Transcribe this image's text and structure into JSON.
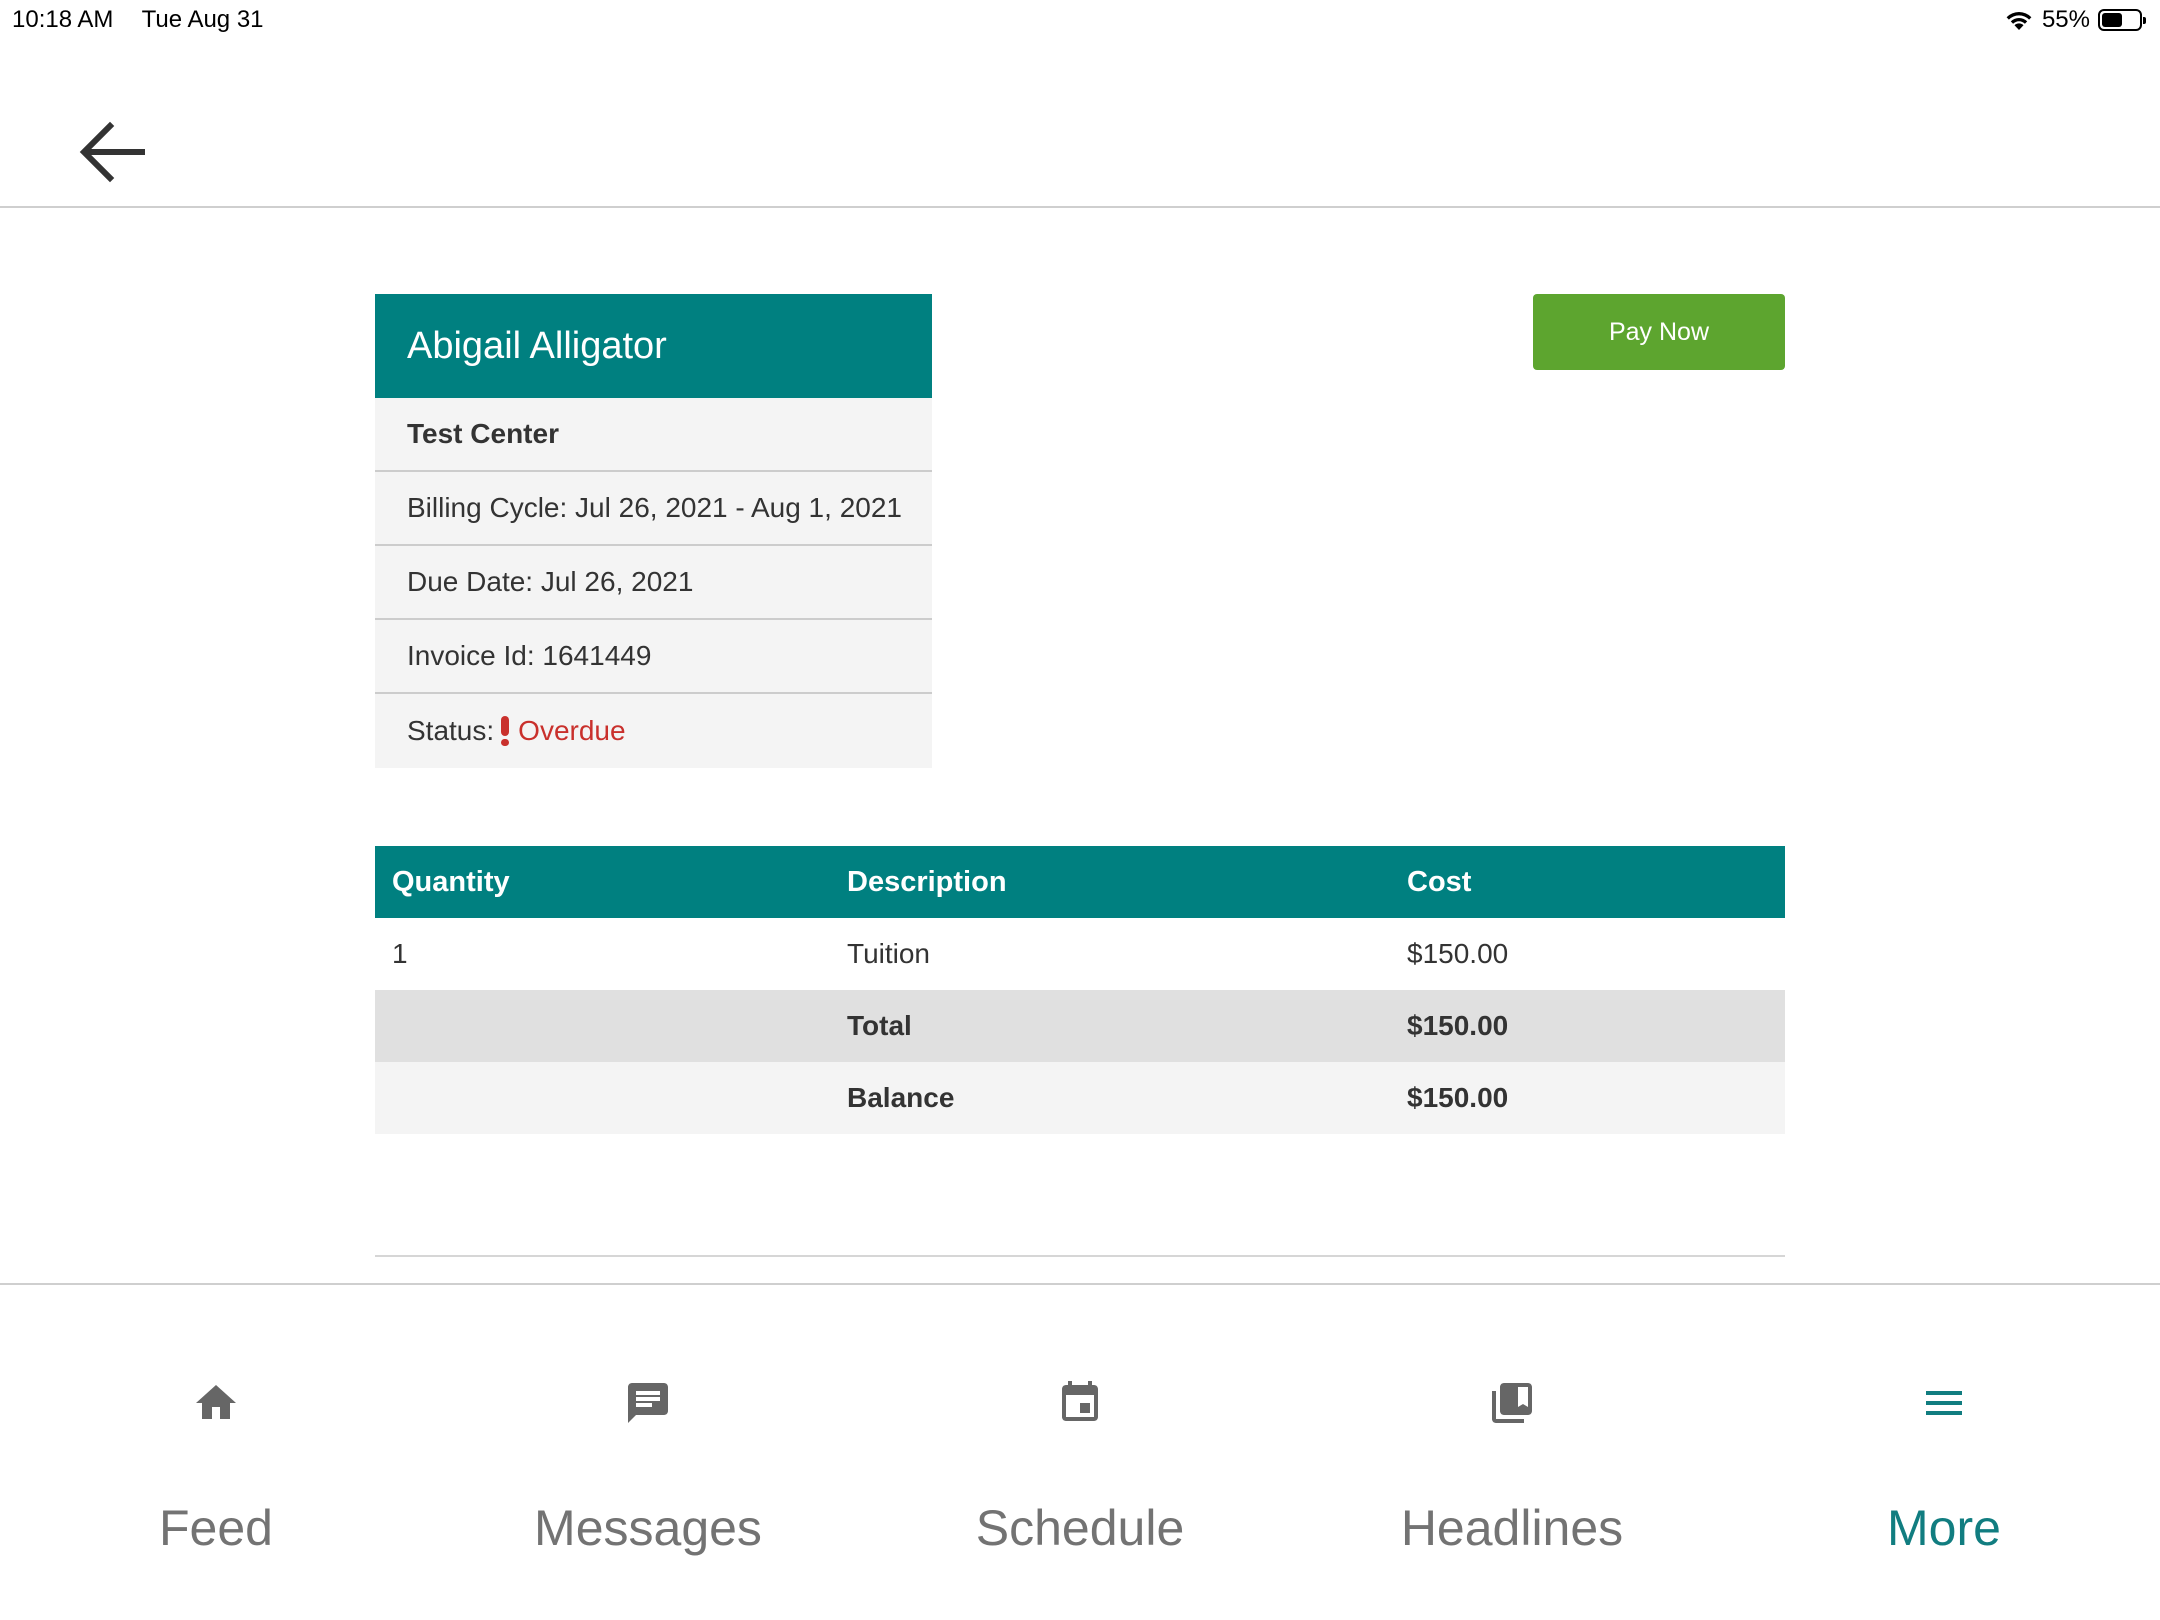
{
  "status_bar": {
    "time": "10:18 AM",
    "date": "Tue Aug 31",
    "battery_percent": "55%",
    "battery_level": 0.55,
    "icons": [
      "wifi-icon",
      "battery-icon"
    ]
  },
  "header": {
    "back_icon": "arrow-left-icon"
  },
  "card": {
    "name": "Abigail Alligator",
    "center": "Test Center",
    "billing_cycle": "Billing Cycle: Jul 26, 2021 - Aug 1, 2021",
    "due_date": "Due Date: Jul 26, 2021",
    "invoice_id": "Invoice Id: 1641449",
    "status_label": "Status:",
    "status_value": "Overdue",
    "status_icon": "exclamation-icon"
  },
  "pay_button": {
    "label": "Pay Now"
  },
  "table": {
    "headers": [
      "Quantity",
      "Description",
      "Cost"
    ],
    "rows": [
      {
        "quantity": "1",
        "description": "Tuition",
        "cost": "$150.00"
      }
    ],
    "total": {
      "label": "Total",
      "value": "$150.00"
    },
    "balance": {
      "label": "Balance",
      "value": "$150.00"
    }
  },
  "tabs": [
    {
      "label": "Feed",
      "icon": "home-icon",
      "active": false
    },
    {
      "label": "Messages",
      "icon": "message-icon",
      "active": false
    },
    {
      "label": "Schedule",
      "icon": "calendar-icon",
      "active": false
    },
    {
      "label": "Headlines",
      "icon": "headlines-icon",
      "active": false
    },
    {
      "label": "More",
      "icon": "menu-icon",
      "active": true
    }
  ],
  "colors": {
    "teal": "#008080",
    "pay_green": "#5da52f",
    "overdue_red": "#c9302c",
    "tab_inactive": "#737373",
    "tab_active": "#117d80"
  }
}
